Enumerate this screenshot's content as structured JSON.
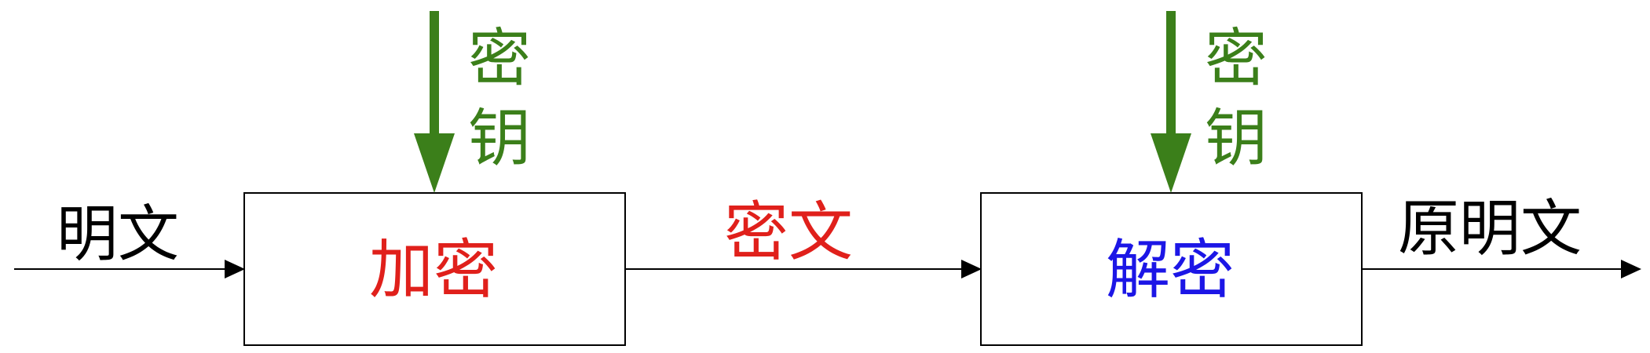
{
  "plaintext_label": "明文",
  "encrypt_box_label": "加密",
  "ciphertext_label": "密文",
  "decrypt_box_label": "解密",
  "recovered_plaintext_label": "原明文",
  "key_label_encrypt": [
    "密",
    "钥"
  ],
  "key_label_decrypt": [
    "密",
    "钥"
  ],
  "colors": {
    "line": "#000000",
    "box_border": "#000000",
    "encrypt_text": "#e0201b",
    "ciphertext_text": "#e0201b",
    "decrypt_text": "#1c16e6",
    "key_color": "#3b7f1a",
    "plain_text": "#000000"
  }
}
